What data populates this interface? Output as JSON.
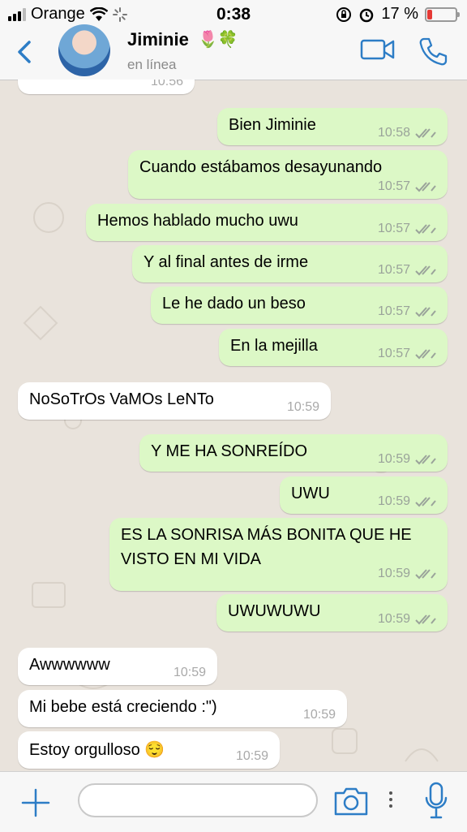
{
  "status_bar": {
    "carrier": "Orange",
    "time": "0:38",
    "battery_percent_label": "17 %",
    "battery_level": 0.17,
    "battery_color": "#e53935"
  },
  "header": {
    "contact_name": "Jiminie",
    "contact_name_emoji": "🌷🍀",
    "status": "en línea",
    "icons": [
      "back-chevron-icon",
      "video-call-icon",
      "phone-icon"
    ],
    "accent": "#2d7dc6"
  },
  "messages": [
    {
      "side": "in",
      "text": "",
      "time": "10:56"
    },
    {
      "side": "out",
      "text": "Bien Jiminie",
      "time": "10:58"
    },
    {
      "side": "out",
      "text": "Cuando estábamos desayunando",
      "time": "10:57"
    },
    {
      "side": "out",
      "text": "Hemos hablado mucho uwu",
      "time": "10:57"
    },
    {
      "side": "out",
      "text": "Y al final antes de irme",
      "time": "10:57"
    },
    {
      "side": "out",
      "text": "Le he dado un beso",
      "time": "10:57"
    },
    {
      "side": "out",
      "text": "En la mejilla",
      "time": "10:57"
    },
    {
      "side": "in",
      "text": "NoSoTrOs VaMOs LeNTo",
      "time": "10:59"
    },
    {
      "side": "out",
      "text": "Y ME HA SONREÍDO",
      "time": "10:59"
    },
    {
      "side": "out",
      "text": "UWU",
      "time": "10:59"
    },
    {
      "side": "out",
      "text": "ES LA SONRISA MÁS BONITA QUE HE VISTO EN MI VIDA",
      "time": "10:59"
    },
    {
      "side": "out",
      "text": "UWUWUWU",
      "time": "10:59"
    },
    {
      "side": "in",
      "text": "Awwwwww",
      "time": "10:59"
    },
    {
      "side": "in",
      "text": "Mi bebe está creciendo :\")",
      "time": "10:59"
    },
    {
      "side": "in",
      "text": "Estoy orgulloso 😌",
      "time": "10:59"
    }
  ],
  "composer": {
    "input_value": "",
    "icons": [
      "plus-icon",
      "camera-icon",
      "more-dots-icon",
      "microphone-icon"
    ]
  },
  "colors": {
    "outgoing_bubble": "#dcf8c6",
    "incoming_bubble": "#ffffff",
    "chat_background": "#e9e3dc",
    "read_ticks": "#9aa39a"
  }
}
